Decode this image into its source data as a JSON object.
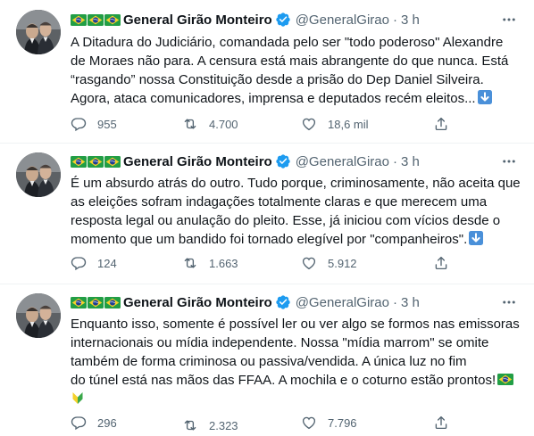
{
  "tweets": [
    {
      "author": "General Girão Monteiro",
      "handle": "@GeneralGirao",
      "time": "3 h",
      "line1": "A Ditadura do Judiciário, comandada pelo ser \"todo poderoso\" Alexandre",
      "line2": "de Moraes não para. A censura está mais abrangente do que nunca. Está",
      "line3": "“rasgando” nossa Constituição desde a prisão do Dep Daniel Silveira.",
      "line4": "Agora, ataca comunicadores, imprensa e deputados recém eleitos...",
      "replies": "955",
      "retweets": "4.700",
      "likes": "18,6 mil"
    },
    {
      "author": "General Girão Monteiro",
      "handle": "@GeneralGirao",
      "time": "3 h",
      "line1": "É um absurdo atrás do outro. Tudo porque, criminosamente, não aceita que",
      "line2": "as eleições sofram indagações totalmente claras e que merecem uma",
      "line3": "resposta legal ou anulação do pleito. Esse, já iniciou com vícios desde o",
      "line4": "momento que um bandido foi tornado elegível por \"companheiros\".",
      "replies": "124",
      "retweets": "1.663",
      "likes": "5.912"
    },
    {
      "author": "General Girão Monteiro",
      "handle": "@GeneralGirao",
      "time": "3 h",
      "line1": "Enquanto isso, somente é possível ler ou ver algo se formos nas emissoras",
      "line2": "internacionais ou mídia independente. Nossa \"mídia marrom\" se omite",
      "line3": "também de forma criminosa ou passiva/vendida. A única luz no fim",
      "line4": "do túnel está nas mãos das FFAA. A mochila e o coturno estão prontos!",
      "replies": "296",
      "retweets": "2.323",
      "likes": "7.796"
    }
  ],
  "separator": "·",
  "colors": {
    "text": "#0f1419",
    "secondary": "#536471",
    "verified": "#1d9bf0",
    "divider": "#eff3f4"
  },
  "icons": {
    "flag": "brazil-flag-icon",
    "verified": "verified-badge-icon",
    "more": "more-icon",
    "reply": "reply-icon",
    "retweet": "retweet-icon",
    "like": "heart-icon",
    "share": "share-icon",
    "down": "down-arrow-emoji-icon",
    "leaf": "japanese-beginner-symbol-icon"
  }
}
